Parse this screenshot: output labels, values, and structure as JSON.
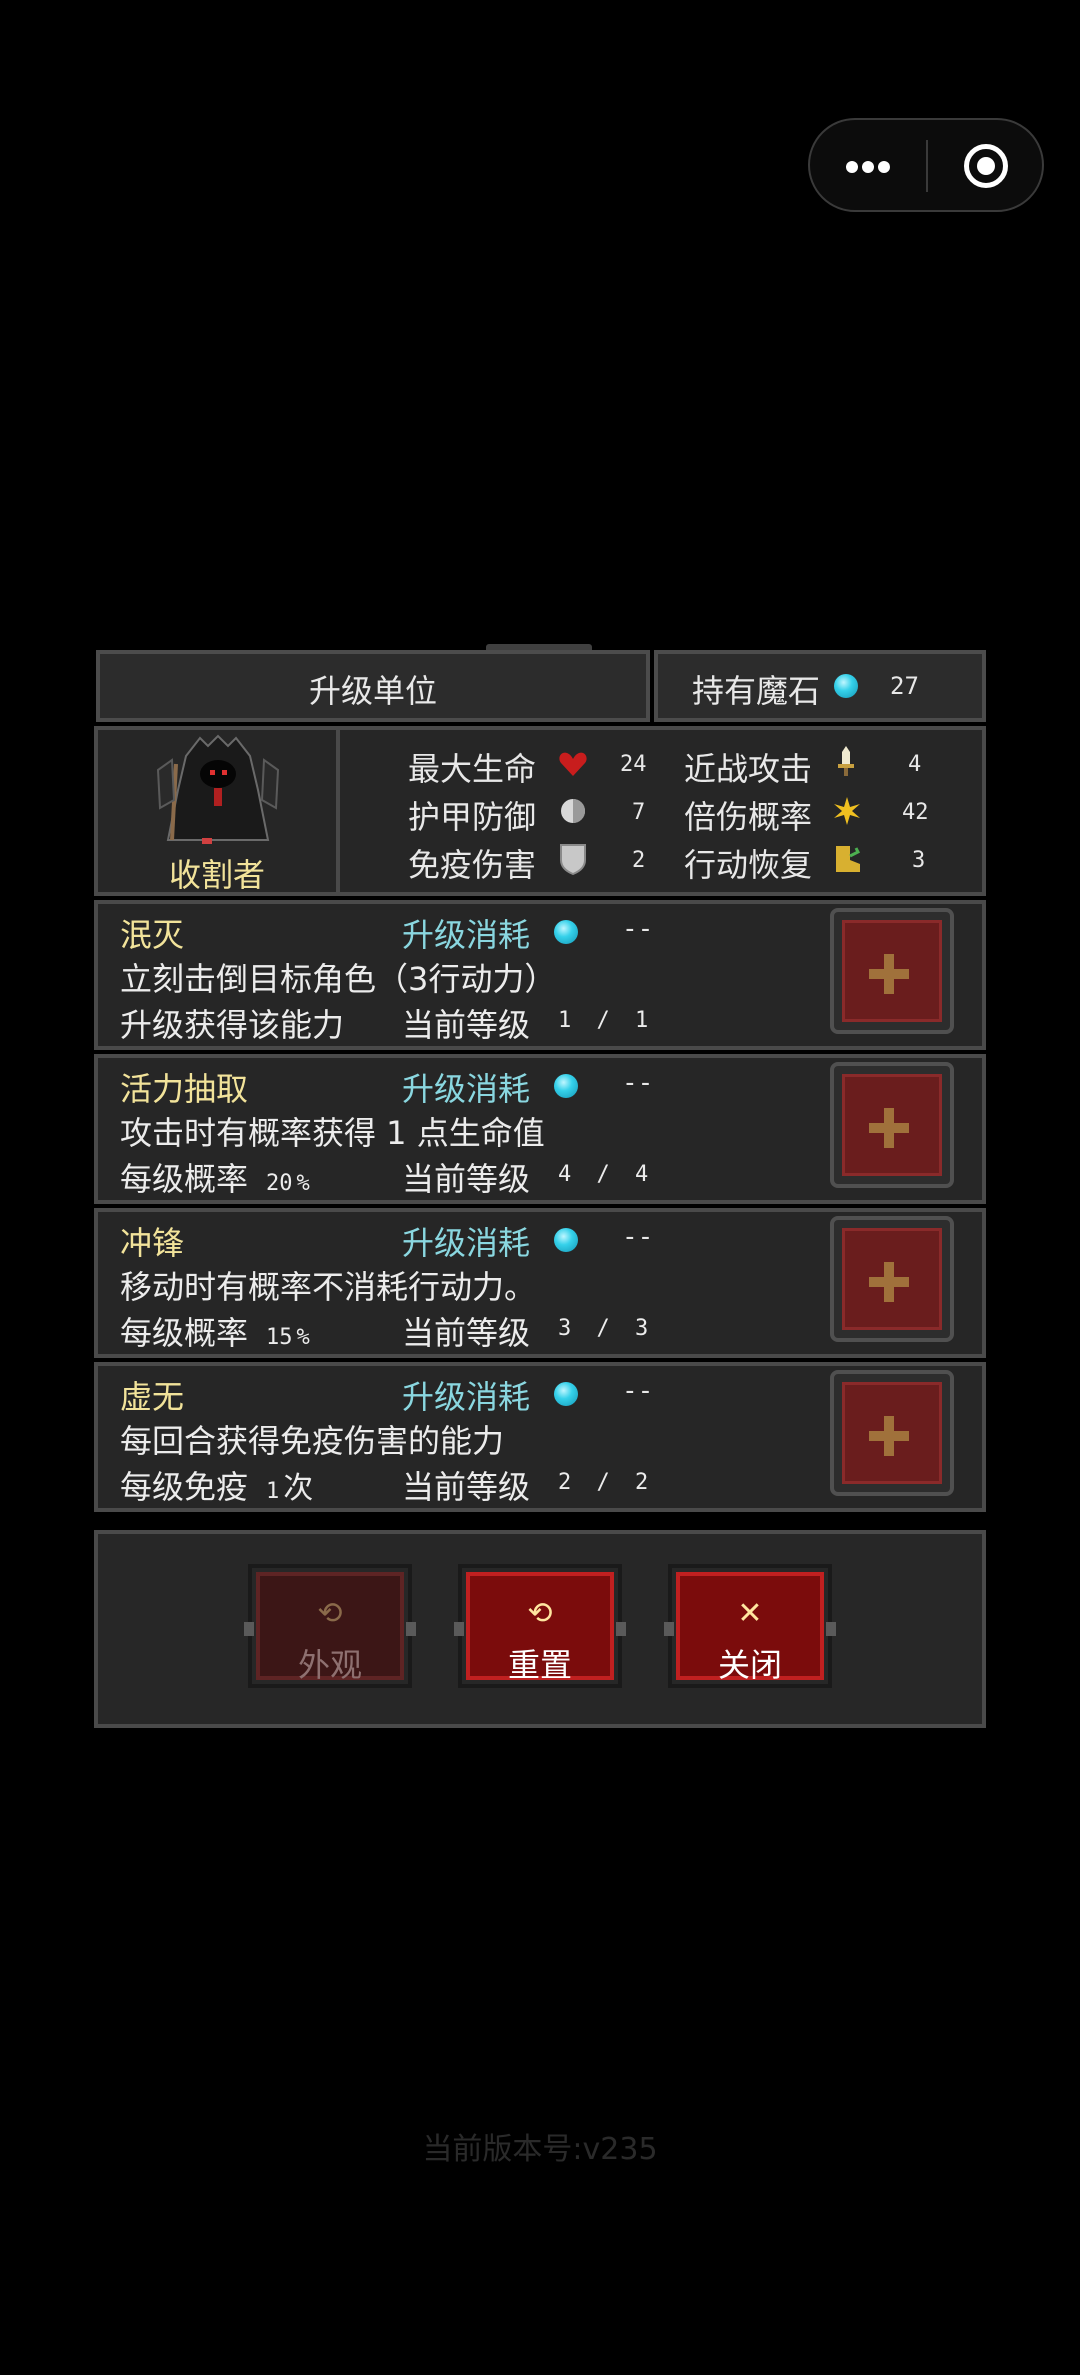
{
  "menu": {
    "more_icon": "more-dots-icon",
    "close_icon": "target-circle-icon"
  },
  "header": {
    "title": "升级单位",
    "stones_label": "持有魔石",
    "stones_value": "27"
  },
  "unit": {
    "name": "收割者",
    "stats": [
      {
        "label": "最大生命",
        "value": "24",
        "icon": "heart-icon",
        "color": "#c81d1d"
      },
      {
        "label": "近战攻击",
        "value": "4",
        "icon": "sword-icon",
        "color": "#e0d8a0"
      },
      {
        "label": "护甲防御",
        "value": "7",
        "icon": "shield-round-icon",
        "color": "#d8d8d8"
      },
      {
        "label": "倍伤概率",
        "value": "42",
        "icon": "star-burst-icon",
        "color": "#f0c020"
      },
      {
        "label": "免疫伤害",
        "value": "2",
        "icon": "shield-icon",
        "color": "#c8c8c8"
      },
      {
        "label": "行动恢复",
        "value": "3",
        "icon": "boot-icon",
        "color": "#d8b030"
      }
    ]
  },
  "skill_common": {
    "cost_label": "升级消耗",
    "level_label": "当前等级"
  },
  "skills": [
    {
      "name": "泯灭",
      "cost": "--",
      "desc": "立刻击倒目标角色（3行动力）",
      "stat_label": "升级获得该能力",
      "stat_value": "",
      "stat_unit": "",
      "level": "1 / 1"
    },
    {
      "name": "活力抽取",
      "cost": "--",
      "desc": "攻击时有概率获得 1 点生命值",
      "stat_label": "每级概率",
      "stat_value": "20",
      "stat_unit": "%",
      "level": "4 / 4"
    },
    {
      "name": "冲锋",
      "cost": "--",
      "desc": "移动时有概率不消耗行动力。",
      "stat_label": "每级概率",
      "stat_value": "15",
      "stat_unit": "%",
      "level": "3 / 3"
    },
    {
      "name": "虚无",
      "cost": "--",
      "desc": "每回合获得免疫伤害的能力",
      "stat_label": "每级免疫",
      "stat_value": "1",
      "stat_unit": "次",
      "level": "2 / 2"
    }
  ],
  "actions": {
    "appearance": "外观",
    "reset": "重置",
    "close": "关闭"
  },
  "version": "当前版本号:v235"
}
